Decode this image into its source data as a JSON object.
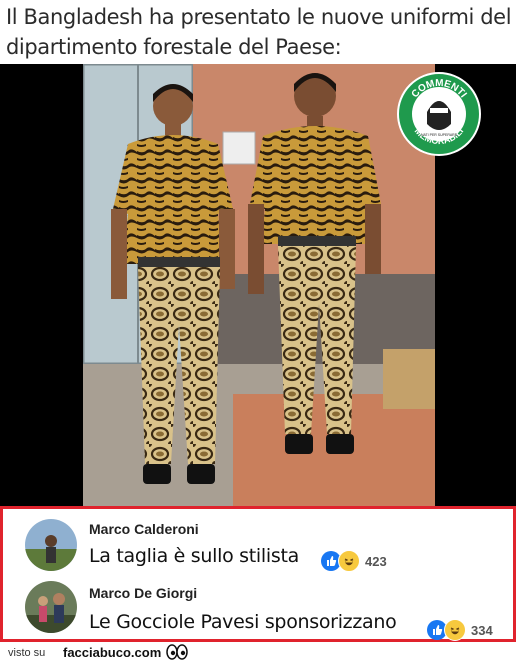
{
  "caption": "Il Bangladesh ha presentato le nuove uniformi del dipartimento forestale del Paese:",
  "badge": {
    "top_text": "COMMENTI",
    "bottom_text": "MEMORABILI",
    "small_text": "NATI PER SUPERARE"
  },
  "comments": [
    {
      "author": "Marco Calderoni",
      "text": "La taglia è sullo stilista",
      "reactions": "423"
    },
    {
      "author": "Marco De Giorgi",
      "text": "Le Gocciole Pavesi sponsorizzano",
      "reactions": "334"
    }
  ],
  "footer": {
    "prefix": "visto su",
    "site": "facciabuco.com"
  },
  "colors": {
    "border_red": "#e0232d",
    "like_blue": "#1877f2",
    "haha_yellow": "#f7c93e",
    "badge_green": "#1f9a4d"
  }
}
